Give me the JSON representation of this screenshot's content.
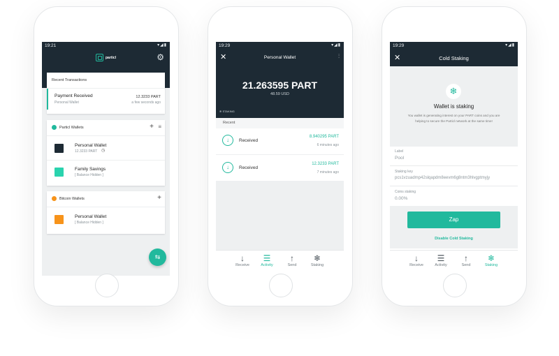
{
  "phone1": {
    "time": "19:21",
    "logo_text": "particl",
    "recent_header": "Recent Transactions",
    "tx": {
      "title": "Payment Received",
      "subtitle": "Personal Wallet",
      "amount": "12.3233 PART",
      "when": "a few seconds ago"
    },
    "particl_wallets_label": "Particl Wallets",
    "wallets": [
      {
        "name": "Personal Wallet",
        "detail": "12.3233 PART"
      },
      {
        "name": "Family Savings",
        "detail": "[ Balance Hidden ]"
      }
    ],
    "bitcoin_wallets_label": "Bitcoin Wallets",
    "btc_wallet": {
      "name": "Personal Wallet",
      "detail": "[ Balance Hidden ]"
    }
  },
  "phone2": {
    "time": "19:29",
    "title": "Personal Wallet",
    "balance": "21.263595 PART",
    "usd": "48.59 USD",
    "staking_badge": "STAKING",
    "recent_label": "Recent",
    "tx": [
      {
        "label": "Received",
        "amount": "8.940295 PART",
        "when": "6 minutes ago"
      },
      {
        "label": "Received",
        "amount": "12.3233 PART",
        "when": "7 minutes ago"
      }
    ],
    "nav": [
      "Receive",
      "Activity",
      "Send",
      "Staking"
    ],
    "active_nav": "Activity"
  },
  "phone3": {
    "time": "19:29",
    "title": "Cold Staking",
    "status_title": "Wallet is staking",
    "status_text": "You wallet is generating interest on your PART coins and you are helping to secure the Particl network at the same time!",
    "fields": [
      {
        "label": "Label",
        "value": "Pool"
      },
      {
        "label": "Staking key",
        "value": "pcs1vzuadmp42slqapdm8eevm6g8ntm3hlvgptmyjy"
      },
      {
        "label": "Coins staking",
        "value": "0.00%"
      }
    ],
    "zap_label": "Zap",
    "disable_label": "Disable Cold Staking",
    "nav": [
      "Receive",
      "Activity",
      "Send",
      "Staking"
    ],
    "active_nav": "Staking"
  },
  "colors": {
    "accent": "#21b99d",
    "dark": "#1d2a34",
    "bitcoin": "#f7931a"
  }
}
